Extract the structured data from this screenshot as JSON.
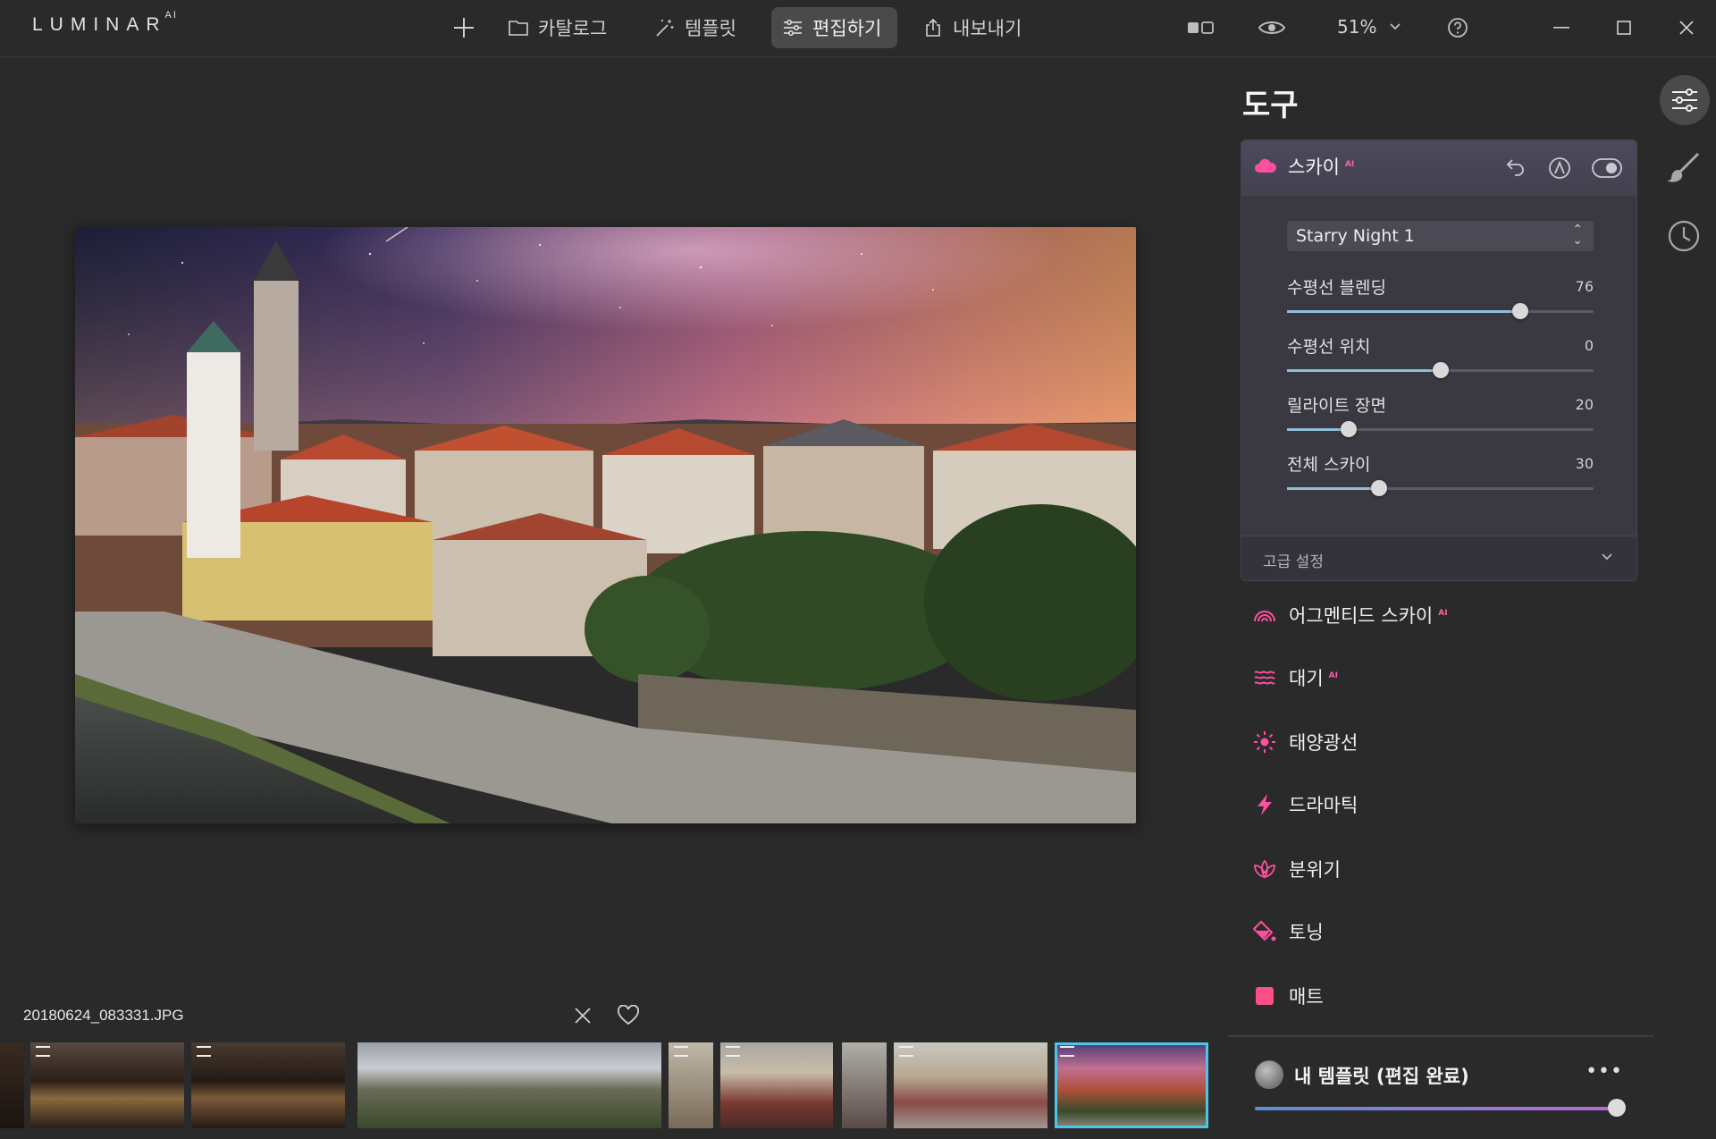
{
  "app": {
    "logo": "LUMINAR",
    "logo_suffix": "AI"
  },
  "nav": {
    "catalog": "카탈로그",
    "templates": "템플릿",
    "edit": "편집하기",
    "export": "내보내기"
  },
  "toolbar": {
    "zoom": "51%"
  },
  "filmstrip": {
    "filename": "20180624_083331.JPG",
    "selected_index": 7
  },
  "panel": {
    "title": "도구",
    "sky": {
      "label": "스카이",
      "ai_badge": "AI",
      "preset": "Starry Night 1",
      "sliders": [
        {
          "label": "수평선 블렌딩",
          "value": "76",
          "level": 0.76
        },
        {
          "label": "수평선 위치",
          "value": "0",
          "level": 0.5
        },
        {
          "label": "릴라이트 장면",
          "value": "20",
          "level": 0.2
        },
        {
          "label": "전체 스카이",
          "value": "30",
          "level": 0.3
        }
      ],
      "advanced": "고급 설정"
    },
    "tools": [
      {
        "label": "어그멘티드 스카이",
        "ai": "AI",
        "icon": "rainbow-icon"
      },
      {
        "label": "대기",
        "ai": "AI",
        "icon": "waves-icon"
      },
      {
        "label": "태양광선",
        "ai": "",
        "icon": "sun-icon"
      },
      {
        "label": "드라마틱",
        "ai": "",
        "icon": "lightning-icon"
      },
      {
        "label": "분위기",
        "ai": "",
        "icon": "lotus-icon"
      },
      {
        "label": "토닝",
        "ai": "",
        "icon": "paint-bucket-icon"
      },
      {
        "label": "매트",
        "ai": "",
        "icon": "square-icon"
      }
    ],
    "my_template": {
      "label": "내 템플릿 (편집 완료)",
      "more": "•••",
      "amount": 1.0
    }
  },
  "colors": {
    "accent_pink": "#ff4fa0",
    "selection_blue": "#4fc3e8",
    "slider_fill": "#8fbfd8"
  }
}
